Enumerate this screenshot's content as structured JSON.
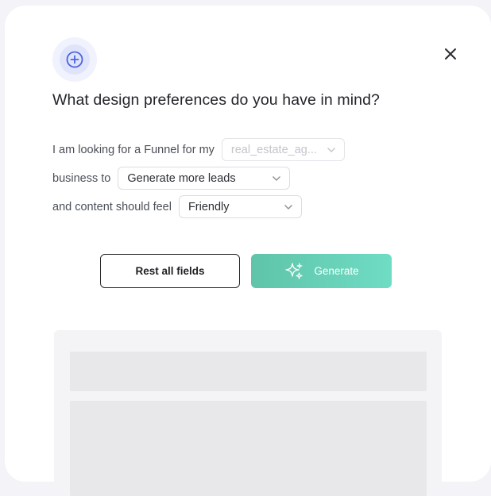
{
  "dialog": {
    "title": "What design preferences do you have in mind?",
    "header_icon": "plus-circle-icon",
    "close_icon": "close-icon"
  },
  "form": {
    "row1_label": "I am looking for a Funnel for my",
    "industry_value": "real_estate_ag...",
    "row2_label": "business to",
    "goal_value": "Generate more leads",
    "row3_label": "and content should feel",
    "tone_value": "Friendly"
  },
  "actions": {
    "reset_label": "Rest all fields",
    "generate_label": "Generate",
    "generate_icon": "sparkle-icon"
  },
  "colors": {
    "accent_green": "#62c8ad",
    "icon_blue": "#4a63e0"
  }
}
